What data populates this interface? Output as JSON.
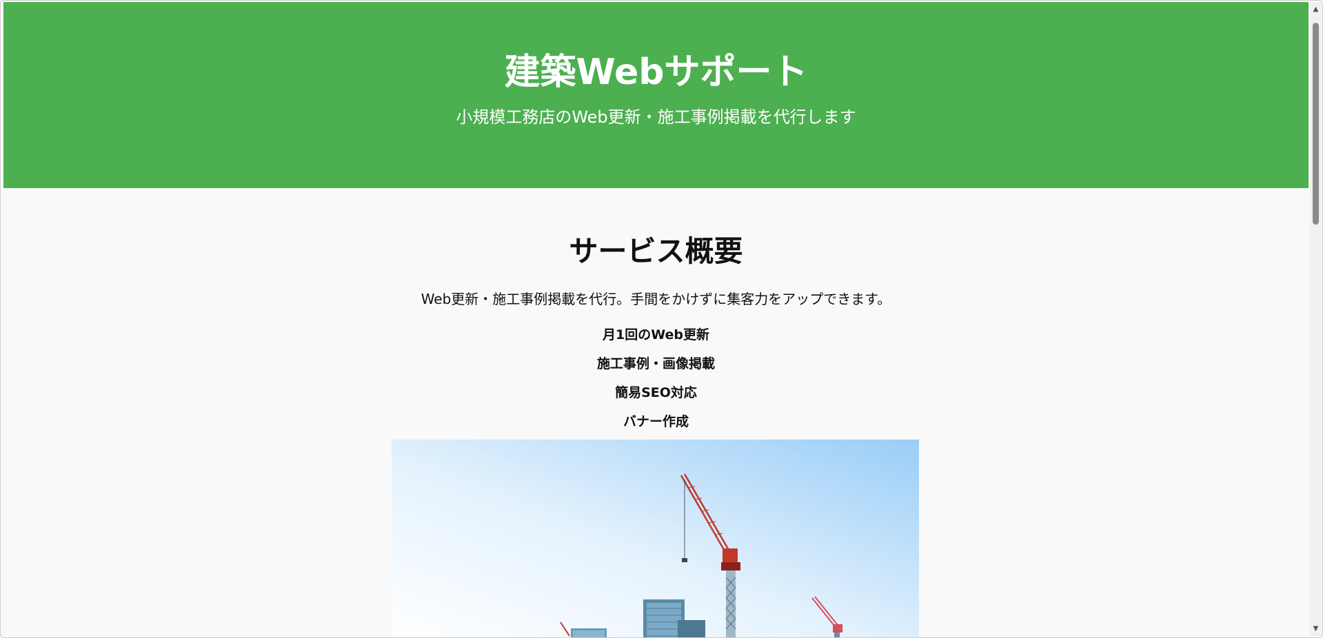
{
  "header": {
    "title": "建築Webサポート",
    "subtitle": "小規模工務店のWeb更新・施工事例掲載を代行します"
  },
  "services": {
    "title": "サービス概要",
    "description": "Web更新・施工事例掲載を代行。手間をかけずに集客力をアップできます。",
    "features": [
      "月1回のWeb更新",
      "施工事例・画像掲載",
      "簡易SEO対応",
      "バナー作成"
    ]
  },
  "colors": {
    "header_bg": "#4caf50",
    "page_bg": "#f9f9f9",
    "header_text": "#ffffff"
  },
  "icons": {
    "scroll_up": "▲",
    "scroll_down": "▼"
  }
}
